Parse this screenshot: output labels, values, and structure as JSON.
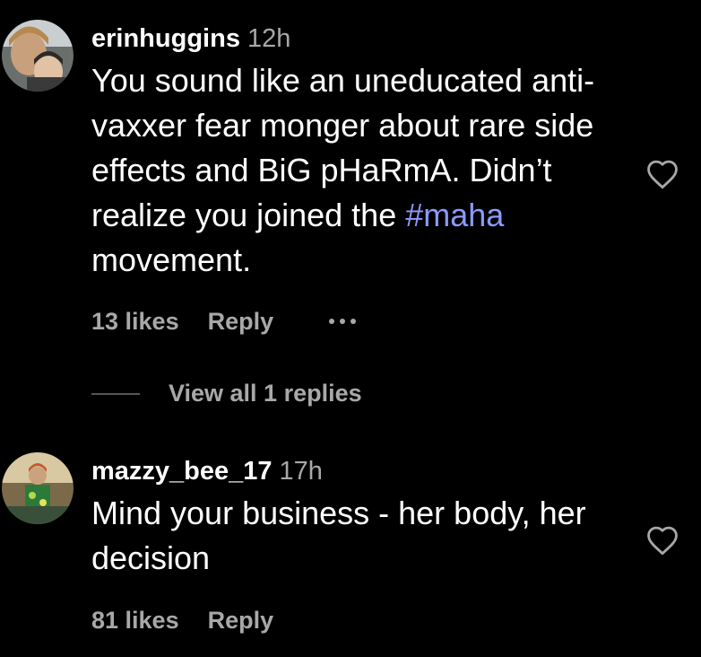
{
  "comments": [
    {
      "username": "erinhuggins",
      "time": "12h",
      "text_parts": {
        "before_tag": "You sound like an uneducated anti-vaxxer fear monger about rare side effects and BiG pHaRmA. Didn’t realize you joined the ",
        "hashtag": "#maha",
        "after_tag": " movement."
      },
      "likes": "13 likes",
      "reply_label": "Reply",
      "has_more_menu": true,
      "avatar_icon": "user-avatar-photo",
      "like_icon": "heart-outline-icon"
    },
    {
      "username": "mazzy_bee_17",
      "time": "17h",
      "text": "Mind your business - her body, her decision",
      "likes": "81 likes",
      "reply_label": "Reply",
      "avatar_icon": "user-avatar-photo",
      "like_icon": "heart-outline-icon"
    }
  ],
  "view_replies": {
    "label": "View all 1 replies"
  },
  "colors": {
    "background": "#000000",
    "text": "#ffffff",
    "secondary_text": "#a8a8a8",
    "hashtag": "#8c9aff"
  }
}
